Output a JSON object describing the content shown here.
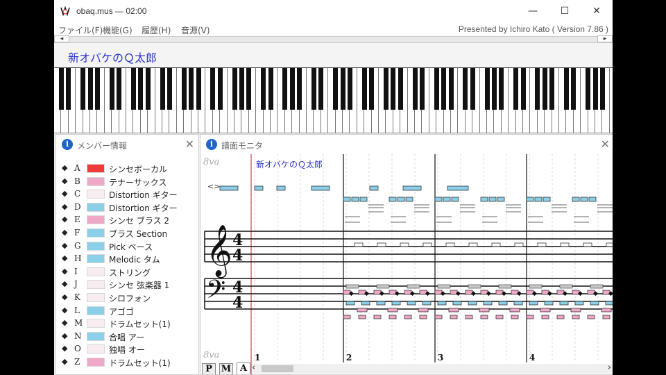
{
  "window": {
    "title": "obaq.mus — 02:00",
    "minimize_glyph": "—",
    "maximize_glyph": "☐",
    "close_glyph": "✕"
  },
  "menu": {
    "items": [
      "ファイル(F)",
      "機能(G)",
      "履歴(H)",
      "音源(V)"
    ],
    "credit": "Presented by Ichiro Kato ( Version 7.86 )"
  },
  "scroll": {
    "left_glyph": "◂",
    "right_glyph": "▸"
  },
  "song": {
    "title": "新オバケのＱ太郎"
  },
  "member_panel": {
    "title": "メンバー情報",
    "icon": "info-icon",
    "close_glyph": "✕",
    "members": [
      {
        "letter": "A",
        "name": "シンセボーカル",
        "color": "#f03a3a"
      },
      {
        "letter": "B",
        "name": "テナーサックス",
        "color": "#f0a8c8"
      },
      {
        "letter": "C",
        "name": "Distortion ギター",
        "color": "#f7ecee"
      },
      {
        "letter": "D",
        "name": "Distortion ギター",
        "color": "#8ccfe8"
      },
      {
        "letter": "E",
        "name": "シンセ ブラス 2",
        "color": "#f0a8c8"
      },
      {
        "letter": "F",
        "name": "ブラス Section",
        "color": "#8ccfe8"
      },
      {
        "letter": "G",
        "name": "Pick ベース",
        "color": "#8ccfe8"
      },
      {
        "letter": "H",
        "name": "Melodic タム",
        "color": "#8ccfe8"
      },
      {
        "letter": "I",
        "name": "ストリング",
        "color": "#f7ecee"
      },
      {
        "letter": "J",
        "name": "シンセ 弦楽器 1",
        "color": "#f7ecee"
      },
      {
        "letter": "K",
        "name": "シロフォン",
        "color": "#f7ecee"
      },
      {
        "letter": "L",
        "name": "アゴゴ",
        "color": "#8ccfe8"
      },
      {
        "letter": "M",
        "name": "ドラムセット(1)",
        "color": "#f7ecee"
      },
      {
        "letter": "N",
        "name": "合唱 アー",
        "color": "#8ccfe8"
      },
      {
        "letter": "O",
        "name": "独唱 オー",
        "color": "#f7ecee"
      },
      {
        "letter": "Z",
        "name": "ドラムセット(1)",
        "color": "#f0a8c8"
      }
    ]
  },
  "score_panel": {
    "title": "譜面モニタ",
    "icon": "info-icon",
    "close_glyph": "✕",
    "ottava_top": "8va",
    "ottava_bottom": "8va",
    "marker": "<>",
    "treble_clef": "𝄞",
    "bass_clef": "𝄢",
    "time_signature_top": "4",
    "time_signature_bottom": "4",
    "song_title": "新オバケのＱ太郎",
    "measures": [
      "1",
      "2",
      "3",
      "4"
    ],
    "tabs": [
      "P",
      "M",
      "A"
    ],
    "active_tab": "A",
    "scroll_left_glyph": "‹",
    "scroll_right_glyph": "›"
  }
}
